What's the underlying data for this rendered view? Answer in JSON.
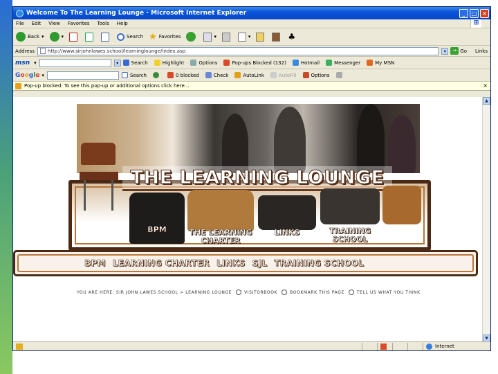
{
  "window": {
    "title": "Welcome To The Learning Lounge - Microsoft Internet Explorer"
  },
  "menu": [
    "File",
    "Edit",
    "View",
    "Favorites",
    "Tools",
    "Help"
  ],
  "toolbar": {
    "back": "Back",
    "search": "Search",
    "favorites": "Favorites"
  },
  "address": {
    "label": "Address",
    "url": "http://www.sirjohnlawes.school/learninglounge/index.asp",
    "go": "Go",
    "links": "Links"
  },
  "msn": {
    "logo": "msn",
    "search": "Search",
    "highlight": "Highlight",
    "options": "Options",
    "popups": "Pop-ups Blocked (132)",
    "hotmail": "Hotmail",
    "messenger": "Messenger",
    "mymsn": "My MSN"
  },
  "google": {
    "search": "Search",
    "blocked": "0 blocked",
    "check": "Check",
    "autolink": "AutoLink",
    "autofill": "AutoFill",
    "options": "Options"
  },
  "infobar": {
    "text": "Pop-up blocked. To see this pop-up or additional options click here..."
  },
  "banner": {
    "title": "THE LEARNING LOUNGE",
    "chairs": [
      "BPM",
      "THE LEARNING CHARTER",
      "LINKS",
      "TRAINING SCHOOL"
    ]
  },
  "nav": [
    "BPM",
    "LEARNING CHARTER",
    "LINKS",
    "SJL",
    "TRAINING SCHOOL"
  ],
  "breadcrumb": {
    "text": "YOU ARE HERE: SIR JOHN LAWES SCHOOL > LEARNING LOUNGE",
    "visitorbook": "VISITORBOOK",
    "bookmark": "BOOKMARK THIS PAGE",
    "tell": "TELL US WHAT YOU THINK"
  },
  "status": {
    "zone": "Internet"
  },
  "colors": {
    "frame": "#4a2a14",
    "accent": "#b8763a",
    "titlebar": "#0a55d8"
  }
}
